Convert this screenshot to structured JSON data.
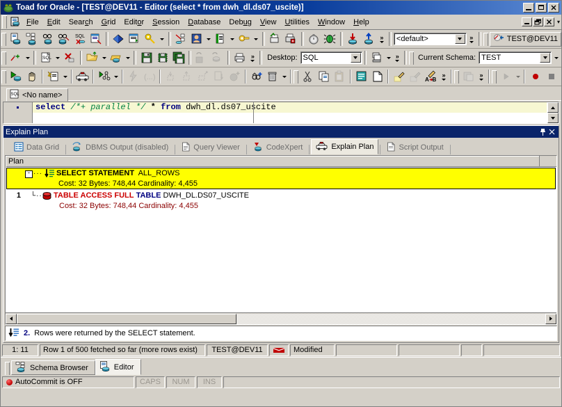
{
  "window": {
    "title": "Toad for Oracle - [TEST@DEV11 - Editor (select * from dwh_dl.ds07_uscite)]",
    "icon": "toad-icon",
    "buttons": {
      "minimize": "_",
      "maximize": "□",
      "close": "✕"
    }
  },
  "menubar": {
    "icon": "mdi-document-icon",
    "items": [
      {
        "label": "File",
        "accel": "F"
      },
      {
        "label": "Edit",
        "accel": "E"
      },
      {
        "label": "Search",
        "accel": "c"
      },
      {
        "label": "Grid",
        "accel": "G"
      },
      {
        "label": "Editor",
        "accel": "o"
      },
      {
        "label": "Session",
        "accel": "S"
      },
      {
        "label": "Database",
        "accel": "D"
      },
      {
        "label": "Debug",
        "accel": "u"
      },
      {
        "label": "View",
        "accel": "V"
      },
      {
        "label": "Utilities",
        "accel": "U"
      },
      {
        "label": "Window",
        "accel": "W"
      },
      {
        "label": "Help",
        "accel": "H"
      }
    ],
    "mdi_buttons": {
      "minimize": "_",
      "restore": "❐",
      "close": "✕"
    },
    "overflow": "▾"
  },
  "toolbar_row1": {
    "buttons": [
      "schema-browser-icon",
      "object-palette-icon",
      "sql-monitor-icon",
      "session-browser-icon",
      "sql-modeler-icon",
      "describe-icon",
      "explain-plan-book-icon",
      "sql-editor-list-icon",
      "master-detail-icon",
      "server-output-icon",
      "user-icon",
      "script-manager-icon",
      "security-icon",
      "compare-icon",
      "print-setup-icon",
      "stopwatch-icon",
      "debug-bug-icon",
      "import-icon",
      "export-icon"
    ],
    "overflow": "»",
    "combo_value": "<default>",
    "connection": "TEST@DEV11",
    "connection_icon": "connection-icon"
  },
  "toolbar_row2": {
    "buttons": [
      "new-connection-icon",
      "new-sql-icon",
      "close-connection-icon",
      "open-file-icon",
      "open-from-db-icon",
      "save-icon",
      "save-as-icon",
      "save-all-icon",
      "commit-icon",
      "rollback-icon",
      "print-icon"
    ],
    "overflow": "»",
    "desktop_label": "Desktop:",
    "desktop_value": "SQL",
    "schema_label": "Current Schema:",
    "schema_value": "TEST",
    "layout_icon": "layout-icon"
  },
  "toolbar_row3": {
    "buttons": [
      "execute-statement-icon",
      "stop-icon",
      "execute-script-icon",
      "explain-plan-car-icon",
      "auto-trace-icon",
      "run-step-icon",
      "step-over-icon",
      "trace-into-icon",
      "step-out-icon",
      "run-to-cursor-icon",
      "set-parameters-icon",
      "add-watch-icon",
      "toggle-breakpoint-icon",
      "delete-breakpoints-icon",
      "cut-icon",
      "copy-icon",
      "paste-icon",
      "format-code-icon",
      "new-page-icon",
      "highlight-icon",
      "unhighlight-icon",
      "replace-icon",
      "save-file-icon",
      "play-icon",
      "record-icon",
      "stop-record-icon"
    ],
    "overflow": "»"
  },
  "editor_tab": {
    "icon": "sql-file-icon",
    "label": "<No name>"
  },
  "sql": {
    "gutter_marker": "bookmark-dot",
    "tokens": [
      {
        "text": "select ",
        "type": "keyword"
      },
      {
        "text": "/*+ parallel */",
        "type": "hint"
      },
      {
        "text": " * ",
        "type": "star"
      },
      {
        "text": "from ",
        "type": "keyword"
      },
      {
        "text": "dwh_dl.ds07_uscite",
        "type": "ident"
      }
    ],
    "plain": "select /*+ parallel */ * from dwh_dl.ds07_uscite"
  },
  "panel": {
    "title": "Explain Plan",
    "pin_icon": "pin-icon",
    "close_icon": "close-icon",
    "tabs": [
      {
        "label": "Data Grid",
        "icon": "data-grid-icon",
        "active": false
      },
      {
        "label": "DBMS Output (disabled)",
        "icon": "dbms-output-icon",
        "active": false
      },
      {
        "label": "Query Viewer",
        "icon": "query-viewer-icon",
        "active": false
      },
      {
        "label": "CodeXpert",
        "icon": "codexpert-icon",
        "active": false
      },
      {
        "label": "Explain Plan",
        "icon": "explain-plan-car-icon",
        "active": true
      },
      {
        "label": "Script Output",
        "icon": "script-output-icon",
        "active": false
      }
    ],
    "column_header": "Plan",
    "tree": [
      {
        "row_number": "",
        "expander": "-",
        "icon": "select-statement-icon",
        "operation": "SELECT STATEMENT",
        "option": "ALL_ROWS",
        "object": "",
        "cost_text": "Cost: 32  Bytes: 748,44  Cardinality: 4,455",
        "highlighted": true
      },
      {
        "row_number": "1",
        "expander": "",
        "icon": "table-icon",
        "operation": "TABLE ACCESS FULL",
        "option": "TABLE",
        "object": "DWH_DL.DS07_USCITE",
        "cost_text": "Cost: 32  Bytes: 748,44  Cardinality: 4,455",
        "highlighted": false
      }
    ],
    "message_icon": "select-statement-icon",
    "message_number": "2.",
    "message_text": "Rows were returned by the SELECT statement."
  },
  "statusbar": {
    "cursor": "1: 11",
    "rows": "Row 1 of 500 fetched so far (more rows exist)",
    "connection": "TEST@DEV11",
    "flag_icon": "red-flag-icon",
    "modified": "Modified",
    "panel4": "",
    "panel5": "",
    "panel6": "",
    "panel7": ""
  },
  "bottom_tabs": [
    {
      "label": "Schema Browser",
      "icon": "schema-browser-icon",
      "active": false
    },
    {
      "label": "Editor",
      "icon": "editor-icon",
      "active": true
    }
  ],
  "bottom_status": {
    "autocommit_icon": "red-circle-icon",
    "autocommit": "AutoCommit is OFF",
    "caps": "CAPS",
    "num": "NUM",
    "ins": "INS"
  },
  "colors": {
    "title_bar": "#0a246a",
    "face": "#d4d0c8",
    "highlight_row": "#ffff00",
    "keyword": "#000080",
    "hint": "#008040",
    "operation_red": "#cc0000",
    "cost": "#8b0000",
    "current_line": "#f7f7d2"
  }
}
